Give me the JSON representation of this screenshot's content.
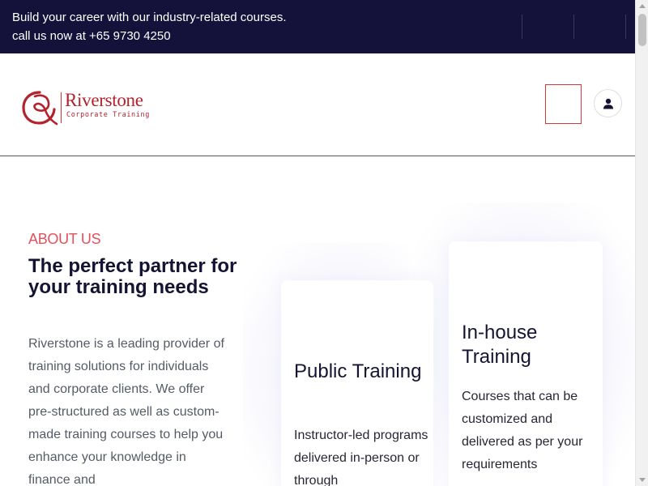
{
  "topbar": {
    "tagline": "Build your career with our industry-related courses.",
    "phone": "call us now at +65 9730 4250",
    "social_icons": [
      "",
      "",
      ""
    ]
  },
  "header": {
    "logo_name": "Riverstone",
    "logo_tagline": "Corporate Training",
    "search_icon_glyph": "",
    "brand_color": "#b3232d",
    "accent_color": "#e4505b"
  },
  "about": {
    "eyebrow": "ABOUT US",
    "heading": "The perfect partner for your training needs",
    "body": "Riverstone is a leading provider of training solutions for individuals and corporate clients. We offer pre-structured as well as custom-made training courses to help you enhance your knowledge in finance and"
  },
  "cards": [
    {
      "title": "Public Training",
      "text": "Instructor-led programs delivered in-person or through"
    },
    {
      "title": "In-house Training",
      "text": "Courses that can be customized and delivered as per your requirements"
    }
  ]
}
